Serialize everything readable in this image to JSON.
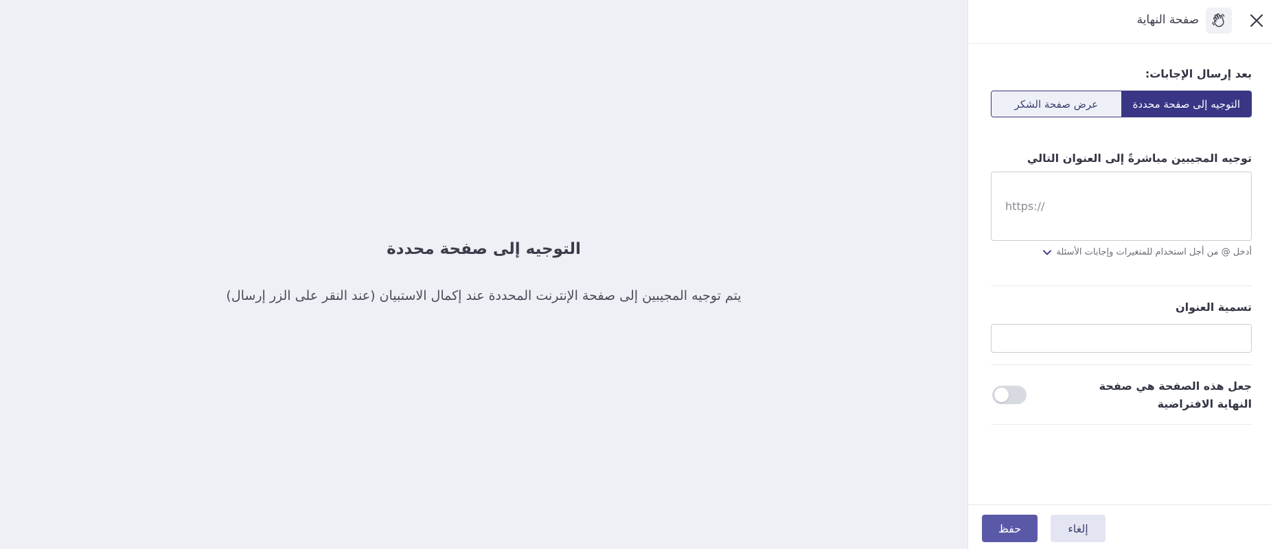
{
  "preview": {
    "title": "التوجيه إلى صفحة محددة",
    "description": "يتم توجيه المجيبين إلى صفحة الإنترنت المحددة عند إكمال الاستبيان (عند النقر على الزر إرسال)"
  },
  "panel": {
    "header_title": "صفحة النهاية",
    "after_submit_label": "بعد إرسال الإجابات:",
    "segments": {
      "redirect": "التوجيه إلى صفحة محددة",
      "thank_you": "عرض صفحة الشكر"
    },
    "redirect_label": "توجيه المجيبين مباشرةً إلى العنوان التالي",
    "url_placeholder": "https://",
    "variables_hint": "أدخل @ من أجل استخدام للمتغيرات وإجابات الأسئلة",
    "address_label_title": "تسمية العنوان",
    "address_label_value": "",
    "default_page_label": "جعل هذه الصفحة هي صفحة النهاية الافتراضية",
    "default_page_enabled": false
  },
  "footer": {
    "save_label": "حفظ",
    "cancel_label": "إلغاء"
  },
  "colors": {
    "accent": "#393686",
    "save_button": "#5a59a8",
    "background": "#eef0f6"
  }
}
